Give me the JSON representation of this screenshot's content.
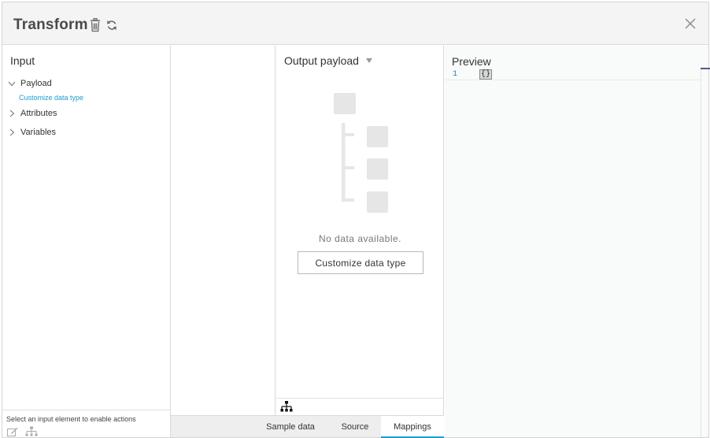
{
  "header": {
    "title": "Transform",
    "icons": [
      "trash-icon",
      "refresh-icon",
      "close-icon"
    ]
  },
  "input": {
    "title": "Input",
    "tree": [
      {
        "label": "Payload",
        "expanded": true,
        "link": "Customize data type"
      },
      {
        "label": "Attributes",
        "expanded": false
      },
      {
        "label": "Variables",
        "expanded": false
      }
    ],
    "footer_hint": "Select an input element to enable actions"
  },
  "output": {
    "title": "Output payload",
    "empty_message": "No data available.",
    "customize_button": "Customize data type"
  },
  "tabs": [
    {
      "label": "Sample data",
      "active": false
    },
    {
      "label": "Source",
      "active": false
    },
    {
      "label": "Mappings",
      "active": true
    }
  ],
  "preview": {
    "title": "Preview",
    "line_number": "1",
    "code": "{}"
  },
  "colors": {
    "accent": "#1a9dd1",
    "header_bg": "#f4f4f4",
    "preview_bg": "#f8fbf9",
    "placeholder": "#e6e6e6"
  }
}
